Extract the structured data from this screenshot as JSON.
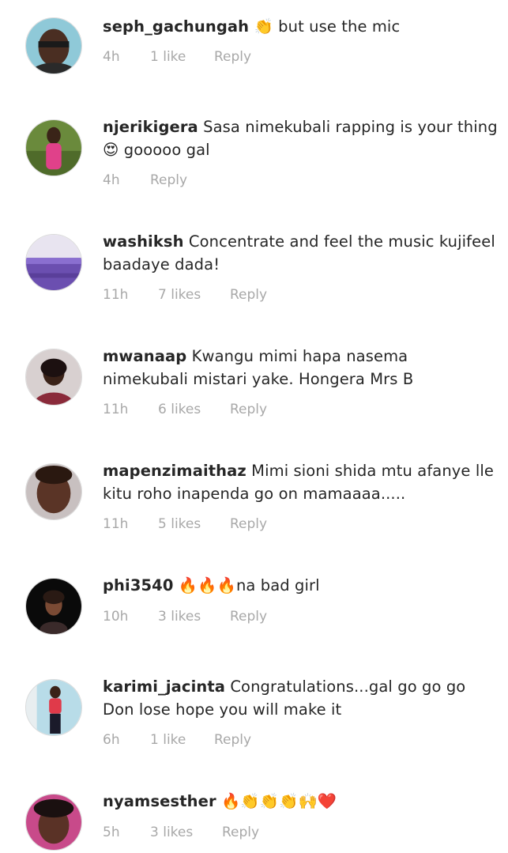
{
  "comments": [
    {
      "username": "seph_gachungah",
      "text": "👏 but use the mic",
      "time": "4h",
      "likes": "1 like",
      "reply": "Reply"
    },
    {
      "username": "njerikigera",
      "text": "Sasa nimekubali rapping is your thing 😍 gooooo gal",
      "time": "4h",
      "likes": "",
      "reply": "Reply"
    },
    {
      "username": "washiksh",
      "text": "Concentrate and feel the music kujifeel baadaye dada!",
      "time": "11h",
      "likes": "7 likes",
      "reply": "Reply"
    },
    {
      "username": "mwanaap",
      "text": "Kwangu mimi hapa nasema nimekubali mistari yake. Hongera Mrs B",
      "time": "11h",
      "likes": "6 likes",
      "reply": "Reply"
    },
    {
      "username": "mapenzimaithaz",
      "text": "Mimi sioni shida mtu afanye lle kitu roho inapenda go on mamaaaa.....",
      "time": "11h",
      "likes": "5 likes",
      "reply": "Reply"
    },
    {
      "username": "phi3540",
      "text": "🔥🔥🔥na bad girl",
      "time": "10h",
      "likes": "3 likes",
      "reply": "Reply"
    },
    {
      "username": "karimi_jacinta",
      "text": "Congratulations...gal go go go Don lose hope you will  make it",
      "time": "6h",
      "likes": "1 like",
      "reply": "Reply"
    },
    {
      "username": "nyamsesther",
      "text": "🔥👏👏👏🙌❤️",
      "time": "5h",
      "likes": "3 likes",
      "reply": "Reply"
    }
  ],
  "colors": {
    "text": "#262626",
    "meta": "#a8a8a8",
    "background": "#ffffff"
  }
}
